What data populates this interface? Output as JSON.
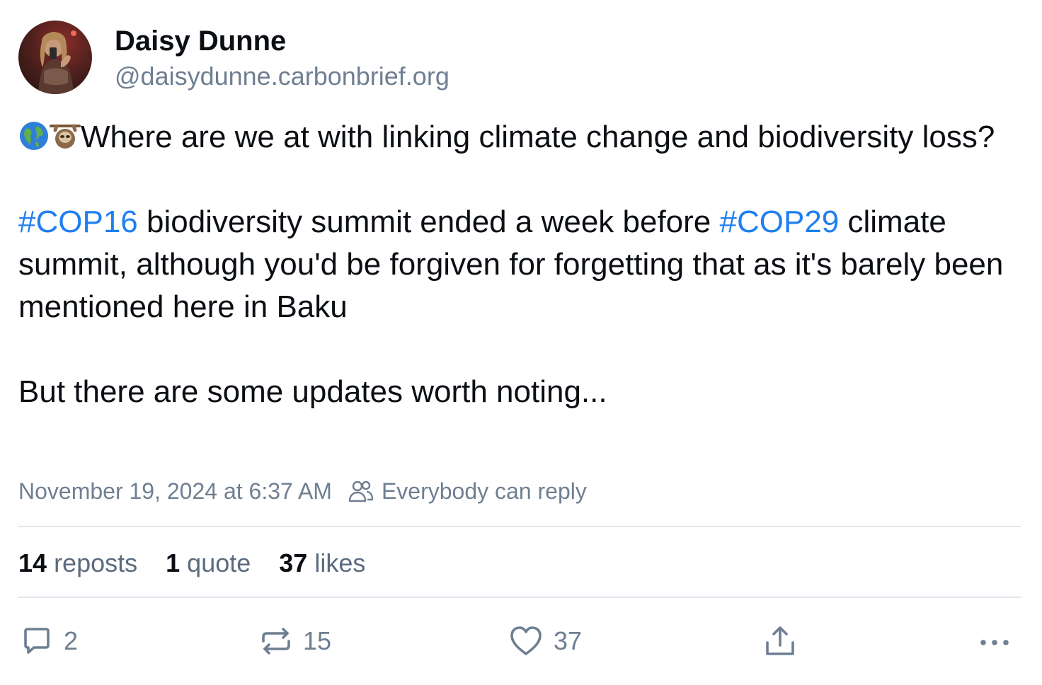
{
  "author": {
    "display_name": "Daisy Dunne",
    "handle": "@daisydunne.carbonbrief.org",
    "avatar_icon": "profile-photo"
  },
  "post": {
    "emojis": [
      "globe-americas-emoji",
      "sloth-emoji"
    ],
    "line1": "Where are we at with linking climate change and biodiversity loss?",
    "hashtag1": "#COP16",
    "mid_text": " biodiversity summit ended a week before ",
    "hashtag2": "#COP29",
    "tail_text": " climate summit, although you'd be forgiven for forgetting that as it's barely been mentioned here in Baku",
    "closing": "But there are some updates worth noting..."
  },
  "meta": {
    "timestamp": "November 19, 2024 at 6:37 AM",
    "reply_setting": "Everybody can reply",
    "reply_icon": "people-icon"
  },
  "stats": {
    "reposts_count": "14",
    "reposts_label": "reposts",
    "quotes_count": "1",
    "quotes_label": "quote",
    "likes_count": "37",
    "likes_label": "likes"
  },
  "actions": {
    "reply_count": "2",
    "repost_count": "15",
    "like_count": "37"
  },
  "colors": {
    "text": "#0b0f14",
    "muted": "#6f7f92",
    "link": "#1f7ff0",
    "divider": "#e2e7ee"
  }
}
